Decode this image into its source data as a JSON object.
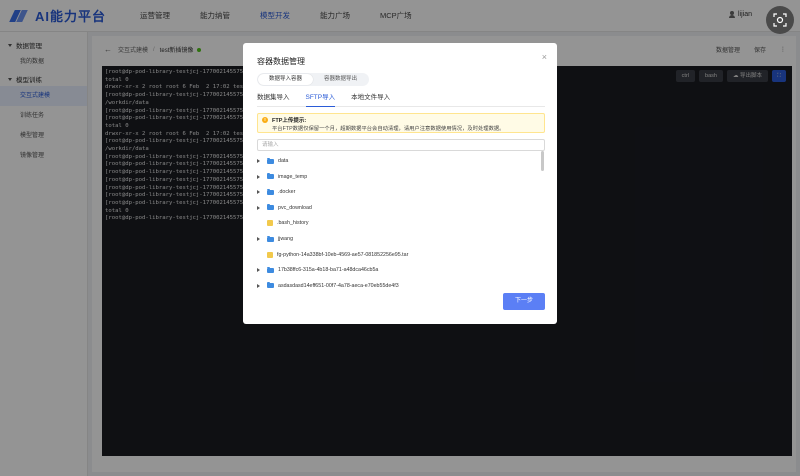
{
  "header": {
    "logo": "AI能力平台",
    "nav": [
      "运营管理",
      "能力纳管",
      "模型开发",
      "能力广场",
      "MCP广场"
    ],
    "active_nav_index": 2,
    "user": "lijian"
  },
  "sidebar": {
    "groups": [
      {
        "label": "数据管理",
        "items": [
          "我的数据"
        ]
      },
      {
        "label": "模型训练",
        "items": [
          "交互式建模",
          "训练任务",
          "模型管理",
          "镜像管理"
        ]
      }
    ],
    "active_item": "交互式建模"
  },
  "breadcrumb": {
    "parent": "交互式建模",
    "current": "test新插镜像"
  },
  "top_actions": {
    "data_manage": "数据管理",
    "save": "保存"
  },
  "terminal": {
    "buttons": {
      "ctrl": "ctrl",
      "bash": "bash",
      "export": "导出脚本"
    },
    "lines": [
      "[root@dp-pod-library-testjcj-1770021455756",
      "total 0",
      "drwxr-xr-x 2 root root 6 Feb  2 17:02 test",
      "[root@dp-pod-library-testjcj-1770021455756",
      "/workdir/data",
      "[root@dp-pod-library-testjcj-1770021455756",
      "[root@dp-pod-library-testjcj-1770021455756",
      "total 0",
      "drwxr-xr-x 2 root root 6 Feb  2 17:02 test",
      "[root@dp-pod-library-testjcj-1770021455756",
      "/workdir/data",
      "[root@dp-pod-library-testjcj-1770021455756",
      "[root@dp-pod-library-testjcj-1770021455756",
      "[root@dp-pod-library-testjcj-1770021455756",
      "[root@dp-pod-library-testjcj-1770021455756",
      "[root@dp-pod-library-testjcj-1770021455756",
      "[root@dp-pod-library-testjcj-1770021455756",
      "[root@dp-pod-library-testjcj-1770021455756",
      "total 0",
      "[root@dp-pod-library-testjcj-1770021455756"
    ]
  },
  "modal": {
    "title": "容器数据管理",
    "segments": [
      "数据导入容器",
      "容器数据导出"
    ],
    "active_segment": 0,
    "tabs": [
      "数据集导入",
      "SFTP导入",
      "本地文件导入"
    ],
    "active_tab": 1,
    "notice_title": "FTP上传提示:",
    "notice_text": "平台FTP数据仅保留一个月，超期数据平台会自动清理，请用户注意数据使用情况，及时处理数据。",
    "path_placeholder": "请输入",
    "tree": [
      {
        "name": "data",
        "type": "folder",
        "expandable": true
      },
      {
        "name": "image_temp",
        "type": "folder",
        "expandable": true
      },
      {
        "name": ".docker",
        "type": "folder",
        "expandable": true
      },
      {
        "name": "pvc_download",
        "type": "folder",
        "expandable": true
      },
      {
        "name": ".bash_history",
        "type": "file",
        "expandable": false
      },
      {
        "name": "jjwang",
        "type": "folder",
        "expandable": true
      },
      {
        "name": "fg-python-14a338bf-10eb-4569-ae57-081852256e95.tar",
        "type": "file",
        "expandable": false
      },
      {
        "name": "17b38ffc6-315a-4b18-ba71-a48dca46cb5a",
        "type": "folder",
        "expandable": true
      },
      {
        "name": "asdasdasd14eff651-00f7-4a78-aeca-e70eb55de4f3",
        "type": "folder",
        "expandable": true
      }
    ],
    "next_label": "下一步"
  }
}
